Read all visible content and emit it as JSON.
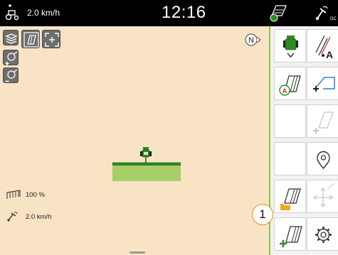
{
  "topbar": {
    "speed": "2.0 km/h",
    "clock": "12:16",
    "icons": [
      "tractor-speed-icon",
      "gps-status-icon",
      "gps-correction-icon"
    ]
  },
  "map": {
    "buttons": [
      "layers-icon",
      "field-view-icon",
      "fit-view-icon",
      "zoom-in-icon",
      "zoom-out-icon"
    ],
    "compass_label": "N",
    "status": {
      "coverage_label": "100 %",
      "gps_speed_label": "2.0 km/h"
    }
  },
  "panel": {
    "buttons": [
      "machine-select-icon",
      "guidance-line-a-icon",
      "field-record-icon",
      "add-boundary-icon",
      "empty-slot",
      "headland-icon",
      "empty-slot",
      "location-pin-icon",
      "field-open-icon",
      "move-icon",
      "new-field-icon",
      "settings-gear-icon"
    ]
  },
  "callout": {
    "label": "1"
  },
  "colors": {
    "accent_green": "#8cc63f",
    "field_background": "#f8e4c4",
    "implement_green": "#2e8b22",
    "callout_orange": "#e08a1e"
  }
}
